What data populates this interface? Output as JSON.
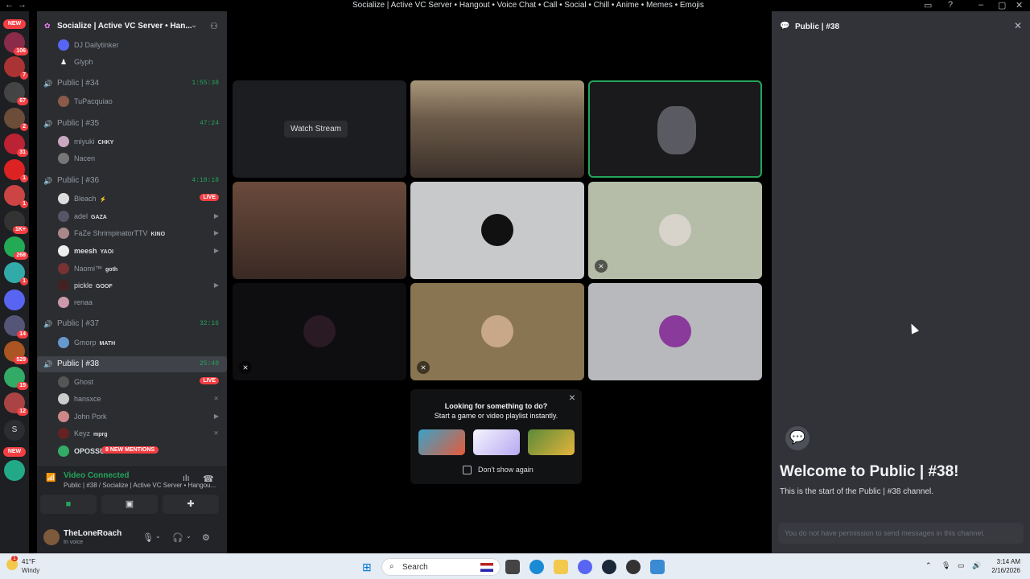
{
  "window": {
    "title": "Socialize | Active VC Server • Hangout • Voice Chat • Call • Social • Chill • Anime • Memes • Emojis"
  },
  "guilds": {
    "new_label": "NEW",
    "badges": [
      "106",
      "7",
      "67",
      "2",
      "31",
      "1",
      "1",
      "1K+",
      "268",
      "1",
      "14",
      "529",
      "15",
      "12"
    ],
    "letter": "S"
  },
  "server": {
    "name": "Socialize | Active VC Server • Han..."
  },
  "channels": {
    "pre_users": [
      "DJ Dailytinker",
      "Glyph"
    ],
    "list": [
      {
        "name": "Public | #34",
        "time": "1:55:38"
      },
      {
        "name": "Public | #35",
        "time": "47:24"
      },
      {
        "name": "Public | #36",
        "time": "4:18:18"
      },
      {
        "name": "Public | #37",
        "time": "32:16"
      },
      {
        "name": "Public | #38",
        "time": "25:40"
      }
    ],
    "c34_users": [
      "TuPacquiao"
    ],
    "c35_users": [
      {
        "name": "miyuki",
        "tag": "CHKY"
      },
      {
        "name": "Nacen",
        "tag": ""
      }
    ],
    "c36_users": [
      {
        "name": "Bleach",
        "tag": "⚡",
        "right": "LIVE"
      },
      {
        "name": "adel",
        "tag": "GAZA",
        "right": "▶"
      },
      {
        "name": "FaZe ShrimpinatorTTV",
        "tag": "KINO",
        "right": "▶"
      },
      {
        "name": "meesh",
        "tag": "YAOI",
        "right": "▶"
      },
      {
        "name": "Naomi™",
        "tag": "goth",
        "right": ""
      },
      {
        "name": "pickle",
        "tag": "GOOF",
        "right": "▶"
      },
      {
        "name": "renaa",
        "tag": "",
        "right": ""
      }
    ],
    "c37_users": [
      {
        "name": "Gmorp",
        "tag": "MATH"
      }
    ],
    "c38_users": [
      {
        "name": "Ghost",
        "tag": "",
        "right": "LIVE"
      },
      {
        "name": "hansxce",
        "tag": "",
        "right": "⨯"
      },
      {
        "name": "John Pork",
        "tag": "",
        "right": "▶"
      },
      {
        "name": "Keyz",
        "tag": "mprg",
        "right": "⨯"
      },
      {
        "name": "OPOSSU",
        "tag": "",
        "right": ""
      }
    ],
    "mentions": "8 NEW MENTIONS"
  },
  "voice": {
    "status": "Video Connected",
    "sub": "Public | #38 / Socialize | Active VC Server • Hangou..."
  },
  "user": {
    "name": "TheLoneRoach",
    "status": "In voice"
  },
  "stage": {
    "watch_stream": "Watch Stream"
  },
  "promo": {
    "line1": "Looking for something to do?",
    "line2": "Start a game or video playlist instantly.",
    "dont_show": "Don't show again",
    "close": "×"
  },
  "chat": {
    "header": "Public | #38",
    "welcome": "Welcome to Public | #38!",
    "start": "This is the start of the Public | #38 channel.",
    "no_permission": "You do not have permission to send messages in this channel."
  },
  "taskbar": {
    "temp": "41°F",
    "weather": "Windy",
    "search": "Search",
    "time": "3:14 AM",
    "date": "2/16/2026",
    "notif": "1"
  }
}
